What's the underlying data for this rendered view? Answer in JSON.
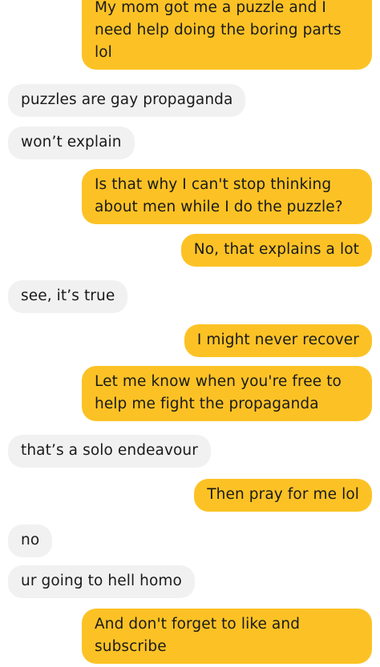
{
  "conversation": {
    "messages": [
      {
        "direction": "sent",
        "text": "My mom got me a puzzle and I\nneed help doing the boring parts\nlol"
      },
      {
        "direction": "received",
        "text": "puzzles are gay propaganda"
      },
      {
        "direction": "received",
        "text": "won’t explain"
      },
      {
        "direction": "sent",
        "text": "Is that why I can't stop thinking\nabout men while I do the puzzle?"
      },
      {
        "direction": "sent",
        "text": "No, that explains a lot"
      },
      {
        "direction": "received",
        "text": "see, it’s true"
      },
      {
        "direction": "sent",
        "text": "I might never recover"
      },
      {
        "direction": "sent",
        "text": "Let me know when you're free to\nhelp me fight the propaganda"
      },
      {
        "direction": "received",
        "text": "that’s a solo endeavour"
      },
      {
        "direction": "sent",
        "text": "Then pray for me lol"
      },
      {
        "direction": "received",
        "text": "no"
      },
      {
        "direction": "received",
        "text": "ur going to hell homo"
      },
      {
        "direction": "sent",
        "text": "And don't forget to like and\nsubscribe"
      }
    ]
  },
  "colors": {
    "sent_bubble": "#fcc225",
    "received_bubble": "#f1f1f1",
    "text": "#1a1a1a",
    "background": "#ffffff"
  }
}
